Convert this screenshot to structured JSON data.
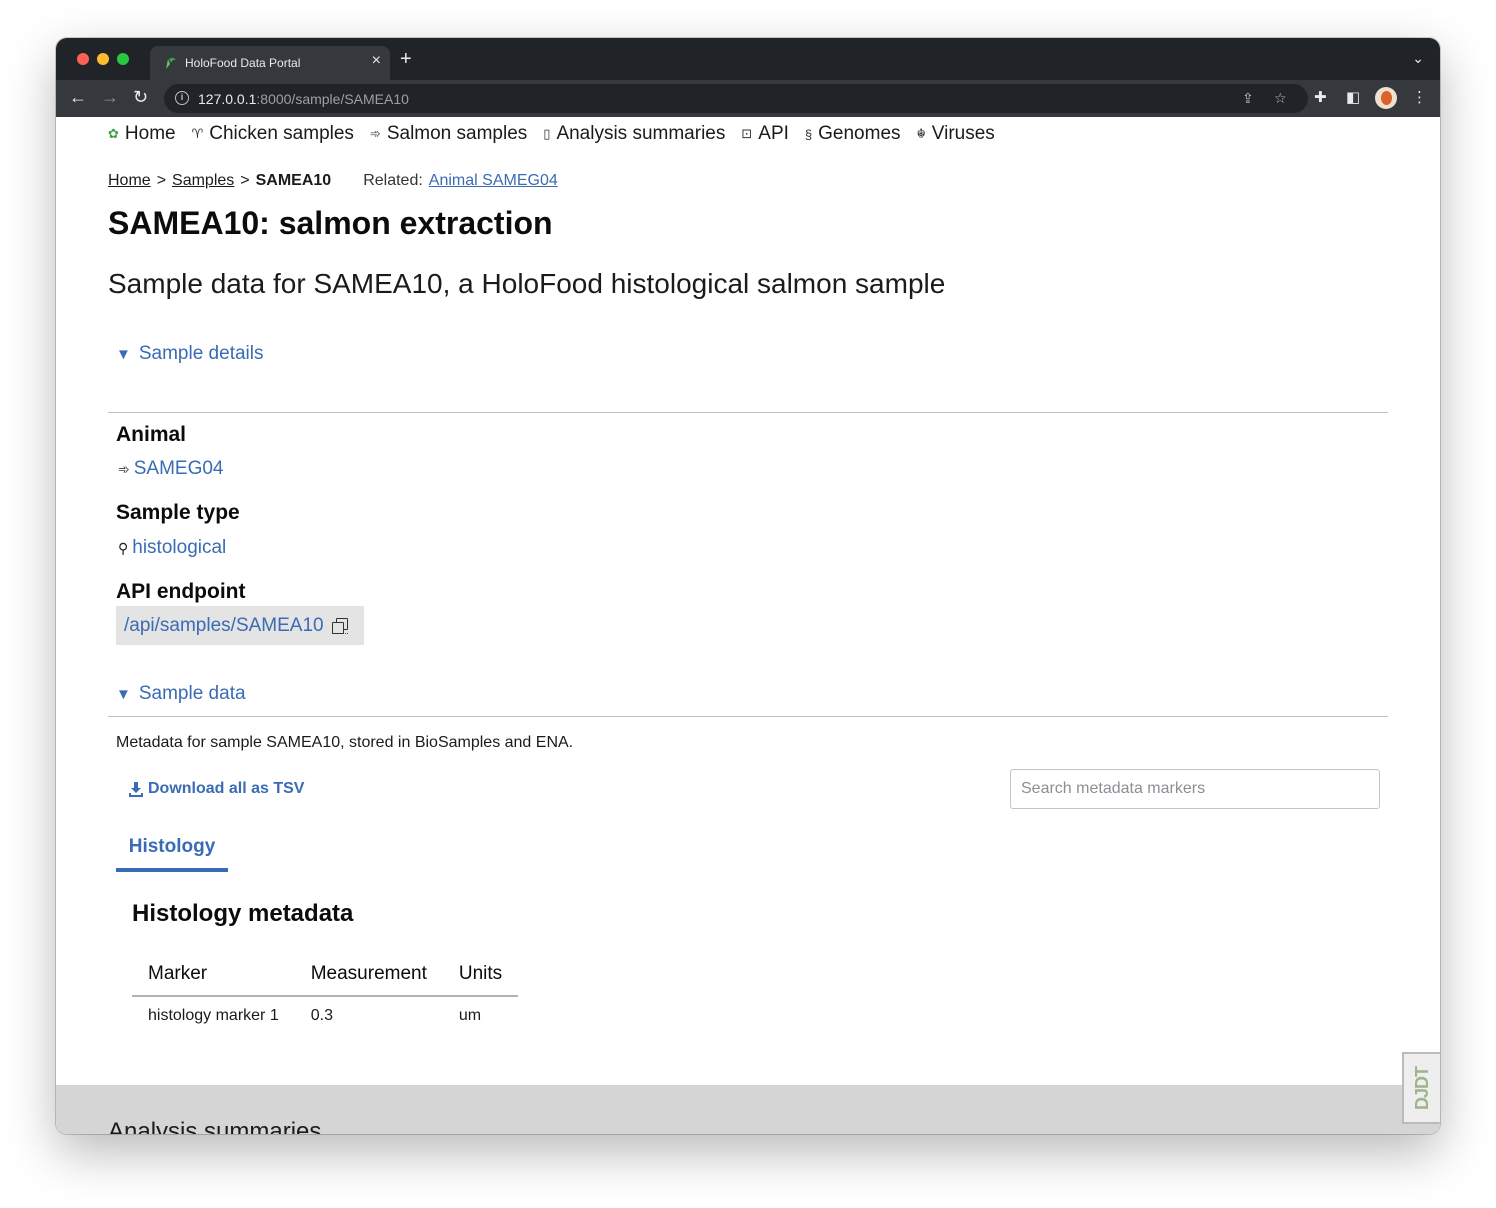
{
  "browser": {
    "tab_title": "HoloFood Data Portal",
    "url_host": "127.0.0.1",
    "url_rest": ":8000/sample/SAMEA10"
  },
  "nav": [
    {
      "label": "Home",
      "icon": "holofood-logo-icon"
    },
    {
      "label": "Chicken samples",
      "icon": "chicken-icon"
    },
    {
      "label": "Salmon samples",
      "icon": "fish-icon"
    },
    {
      "label": "Analysis summaries",
      "icon": "book-icon"
    },
    {
      "label": "API",
      "icon": "terminal-icon"
    },
    {
      "label": "Genomes",
      "icon": "dna-icon"
    },
    {
      "label": "Viruses",
      "icon": "virus-icon"
    }
  ],
  "breadcrumb": {
    "home": "Home",
    "samples": "Samples",
    "sep": ">",
    "current": "SAMEA10",
    "related_label": "Related:",
    "related_link": "Animal SAMEG04"
  },
  "title": "SAMEA10: salmon extraction",
  "subtitle": "Sample data for SAMEA10, a HoloFood histological salmon sample",
  "sample_details": {
    "summary": "Sample details",
    "animal_label": "Animal",
    "animal_value": "SAMEG04",
    "sample_type_label": "Sample type",
    "sample_type_value": "histological",
    "api_label": "API endpoint",
    "api_value": "/api/samples/SAMEA10"
  },
  "sample_data": {
    "summary": "Sample data",
    "note": "Metadata for sample SAMEA10, stored in BioSamples and ENA.",
    "download_label": "Download all as TSV",
    "search_placeholder": "Search metadata markers",
    "tabs": [
      "Histology"
    ],
    "section_title": "Histology metadata",
    "columns": [
      "Marker",
      "Measurement",
      "Units"
    ],
    "rows": [
      {
        "marker": "histology marker 1",
        "measurement": "0.3",
        "units": "um"
      }
    ]
  },
  "footer": {
    "title": "Analysis summaries"
  },
  "debug_toolbar": {
    "label": "DJDT"
  },
  "colors": {
    "link": "#3a6bb5",
    "tab_bar": "#202327",
    "toolbar": "#35393e",
    "footer_bg": "#d5d5d5"
  }
}
